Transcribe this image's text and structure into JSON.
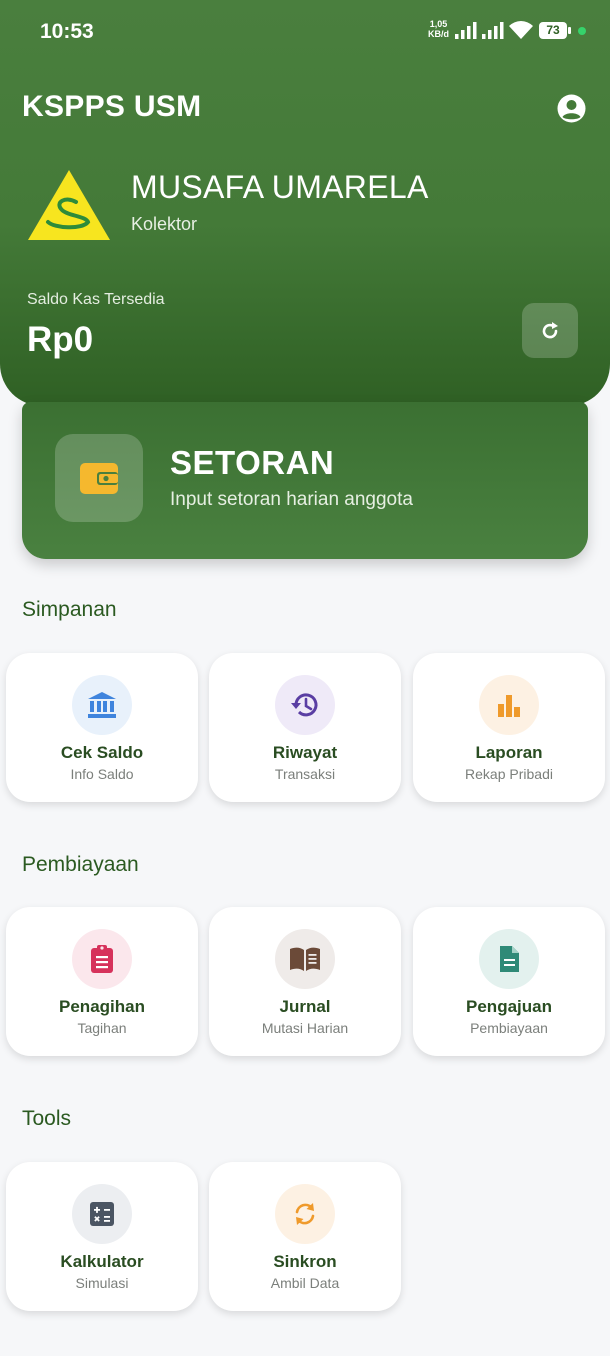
{
  "status_bar": {
    "time": "10:53",
    "net_speed_value": "1,05",
    "net_speed_unit": "KB/d",
    "battery": "73"
  },
  "header": {
    "app_title": "KSPPS USM",
    "user_name": "MUSAFA UMARELA",
    "user_role": "Kolektor",
    "balance_label": "Saldo Kas Tersedia",
    "balance_value": "Rp0"
  },
  "setoran": {
    "title": "SETORAN",
    "subtitle": "Input setoran harian anggota"
  },
  "sections": {
    "simpanan": "Simpanan",
    "pembiayaan": "Pembiayaan",
    "tools": "Tools"
  },
  "tiles": {
    "simpanan": [
      {
        "title": "Cek Saldo",
        "subtitle": "Info Saldo",
        "icon": "bank-icon",
        "color": "#3f84dd"
      },
      {
        "title": "Riwayat",
        "subtitle": "Transaksi",
        "icon": "history-icon",
        "color": "#5a3ea3"
      },
      {
        "title": "Laporan",
        "subtitle": "Rekap Pribadi",
        "icon": "bar-chart-icon",
        "color": "#ef9a2b"
      }
    ],
    "pembiayaan": [
      {
        "title": "Penagihan",
        "subtitle": "Tagihan",
        "icon": "clipboard-icon",
        "color": "#d6325b"
      },
      {
        "title": "Jurnal",
        "subtitle": "Mutasi Harian",
        "icon": "book-icon",
        "color": "#6b4a38"
      },
      {
        "title": "Pengajuan",
        "subtitle": "Pembiayaan",
        "icon": "document-icon",
        "color": "#2f8a77"
      }
    ],
    "tools": [
      {
        "title": "Kalkulator",
        "subtitle": "Simulasi",
        "icon": "calculator-icon",
        "color": "#4b5563"
      },
      {
        "title": "Sinkron",
        "subtitle": "Ambil Data",
        "icon": "sync-icon",
        "color": "#ef9a2b"
      }
    ]
  },
  "colors": {
    "header_green": "#447a38",
    "section_title": "#2b5a21",
    "background": "#f6f7f9"
  }
}
